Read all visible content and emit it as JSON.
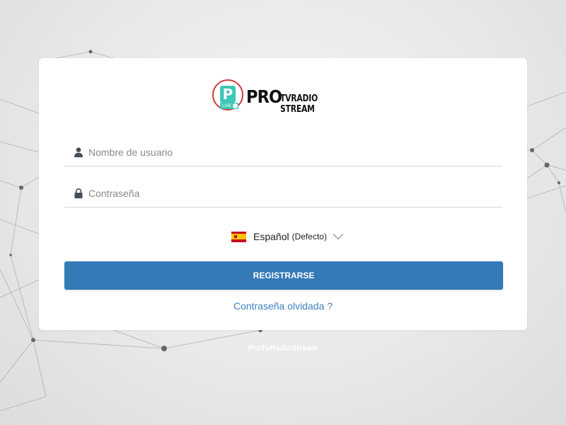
{
  "brand": {
    "badge_letter": "P",
    "badge_live": "LIVE",
    "name_pro": "PRO",
    "name_sub": "TVRADIO STREAM"
  },
  "login": {
    "username_placeholder": "Nombre de usuario",
    "password_placeholder": "Contraseña",
    "username_value": "",
    "password_value": "",
    "username_icon": "user-icon",
    "password_icon": "lock-icon"
  },
  "language": {
    "flag_icon": "spain-flag-icon",
    "selected": "Español",
    "default_note": "(Defecto)"
  },
  "actions": {
    "register_label": "REGISTRARSE",
    "forgot_label": "Contraseña olvidada ?"
  },
  "footer": {
    "text": "ProTvRadioStream"
  },
  "colors": {
    "accent": "#337ab7",
    "link": "#3f7fc2",
    "badge_teal": "#3ec7b6",
    "badge_ring": "#d33a3a"
  }
}
